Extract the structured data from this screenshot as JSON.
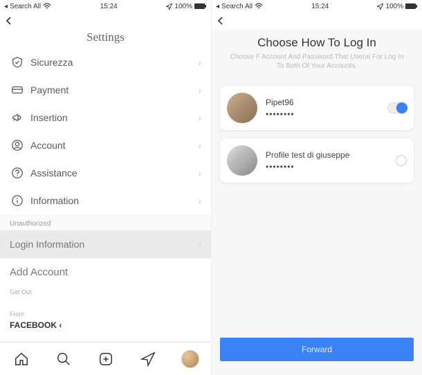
{
  "status": {
    "carrier": "Search All",
    "time": "15:24",
    "battery": "100%"
  },
  "left": {
    "title": "Settings",
    "rows": [
      {
        "label": "Sicurezza"
      },
      {
        "label": "Payment"
      },
      {
        "label": "Insertion"
      },
      {
        "label": "Account"
      },
      {
        "label": "Assistance"
      },
      {
        "label": "Information"
      }
    ],
    "unauthorized": "Unauthorized",
    "login_info": "Login Information",
    "add_account": "Add Account",
    "get_out": "Get Out",
    "from": "From",
    "facebook": "FACEBOOK"
  },
  "right": {
    "title": "Choose How To Log In",
    "subtitle": "Choose F Account And Password That Useral For Log In To Both Of Your Accounts.",
    "accounts": [
      {
        "name": "Pipet96",
        "pass": "••••••••"
      },
      {
        "name": "Profile test di giuseppe",
        "pass": "••••••••"
      }
    ],
    "forward": "Forward"
  }
}
